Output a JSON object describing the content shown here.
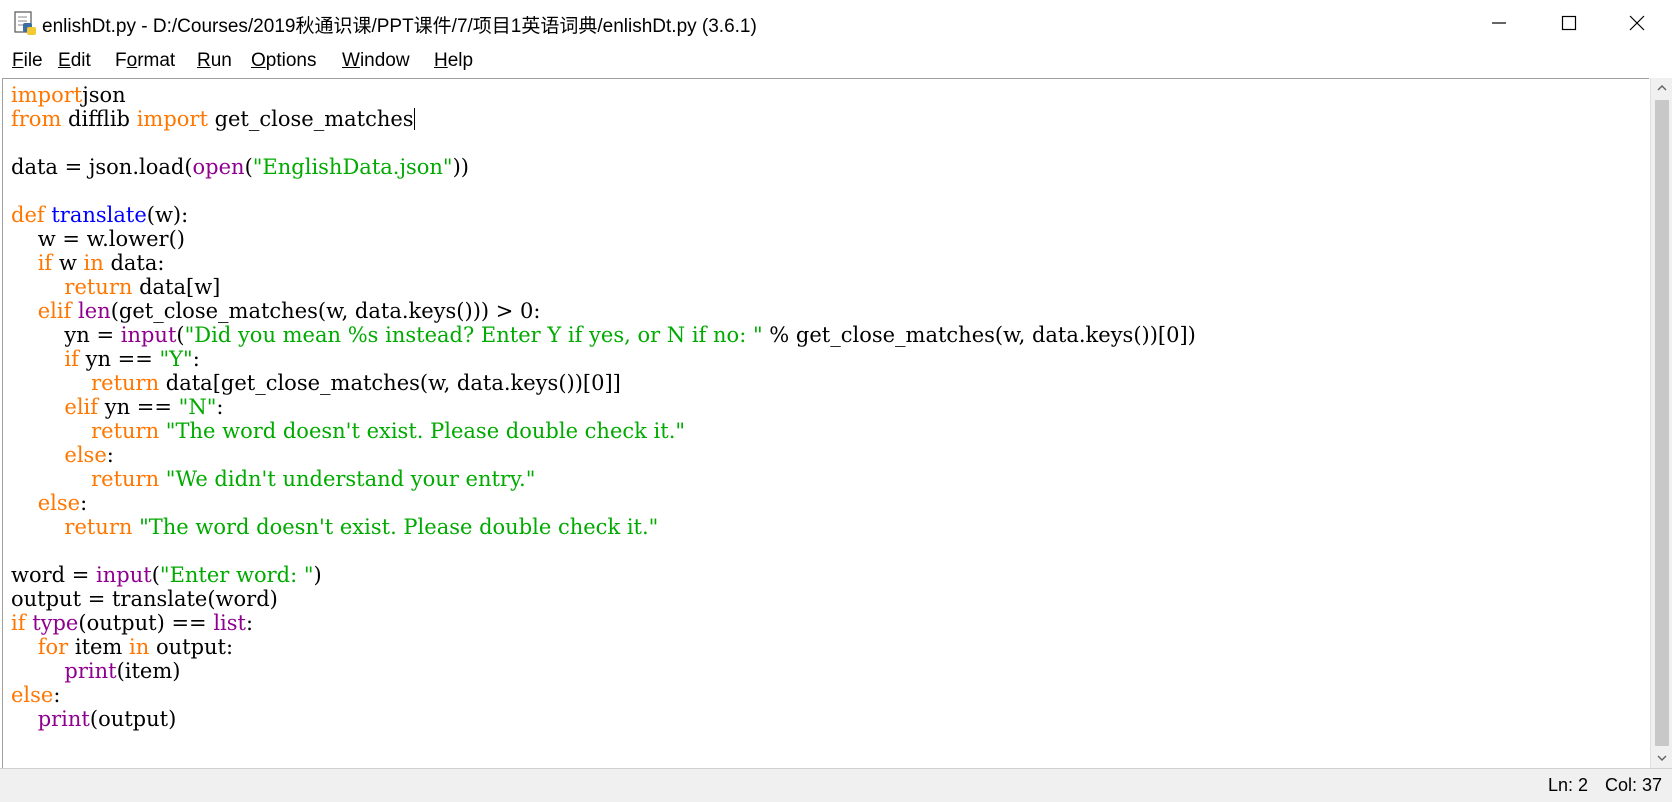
{
  "window": {
    "title": "enlishDt.py - D:/Courses/2019秋通识课/PPT课件/7/项目1英语词典/enlishDt.py (3.6.1)",
    "controls": {
      "minimize_icon": "minimize-icon",
      "maximize_icon": "maximize-icon",
      "close_icon": "close-icon"
    }
  },
  "menu": {
    "items": [
      {
        "pre": "",
        "u": "F",
        "post": "ile"
      },
      {
        "pre": "",
        "u": "E",
        "post": "dit"
      },
      {
        "pre": "F",
        "u": "o",
        "post": "rmat"
      },
      {
        "pre": "",
        "u": "R",
        "post": "un"
      },
      {
        "pre": "",
        "u": "O",
        "post": "ptions"
      },
      {
        "pre": "",
        "u": "W",
        "post": "indow"
      },
      {
        "pre": "",
        "u": "H",
        "post": "elp"
      }
    ]
  },
  "editor": {
    "lines": [
      [
        [
          "kw",
          "import"
        ],
        [
          "",
          "json"
        ]
      ],
      [
        [
          "kw",
          "from"
        ],
        [
          "",
          " difflib "
        ],
        [
          "kw",
          "import"
        ],
        [
          "",
          " get_close_matches"
        ],
        [
          "caret",
          ""
        ]
      ],
      [],
      [
        [
          "",
          "data = json.load("
        ],
        [
          "bi",
          "open"
        ],
        [
          "",
          "("
        ],
        [
          "str",
          "\"EnglishData.json\""
        ],
        [
          "",
          "))"
        ]
      ],
      [],
      [
        [
          "kw",
          "def"
        ],
        [
          "",
          " "
        ],
        [
          "def",
          "translate"
        ],
        [
          "",
          "(w):"
        ]
      ],
      [
        [
          "",
          "    w = w.lower()"
        ]
      ],
      [
        [
          "",
          "    "
        ],
        [
          "kw",
          "if"
        ],
        [
          "",
          " w "
        ],
        [
          "kw",
          "in"
        ],
        [
          "",
          " data:"
        ]
      ],
      [
        [
          "",
          "        "
        ],
        [
          "kw",
          "return"
        ],
        [
          "",
          " data[w]"
        ]
      ],
      [
        [
          "",
          "    "
        ],
        [
          "kw",
          "elif"
        ],
        [
          "",
          " "
        ],
        [
          "bi",
          "len"
        ],
        [
          "",
          "(get_close_matches(w, data.keys())) > 0:"
        ]
      ],
      [
        [
          "",
          "        yn = "
        ],
        [
          "bi",
          "input"
        ],
        [
          "",
          "("
        ],
        [
          "str",
          "\"Did you mean %s instead? Enter Y if yes, or N if no: \""
        ],
        [
          "",
          " % get_close_matches(w, data.keys())[0])"
        ]
      ],
      [
        [
          "",
          "        "
        ],
        [
          "kw",
          "if"
        ],
        [
          "",
          " yn == "
        ],
        [
          "str",
          "\"Y\""
        ],
        [
          "",
          ":"
        ]
      ],
      [
        [
          "",
          "            "
        ],
        [
          "kw",
          "return"
        ],
        [
          "",
          " data[get_close_matches(w, data.keys())[0]]"
        ]
      ],
      [
        [
          "",
          "        "
        ],
        [
          "kw",
          "elif"
        ],
        [
          "",
          " yn == "
        ],
        [
          "str",
          "\"N\""
        ],
        [
          "",
          ":"
        ]
      ],
      [
        [
          "",
          "            "
        ],
        [
          "kw",
          "return"
        ],
        [
          "",
          " "
        ],
        [
          "str",
          "\"The word doesn't exist. Please double check it.\""
        ]
      ],
      [
        [
          "",
          "        "
        ],
        [
          "kw",
          "else"
        ],
        [
          "",
          ":"
        ]
      ],
      [
        [
          "",
          "            "
        ],
        [
          "kw",
          "return"
        ],
        [
          "",
          " "
        ],
        [
          "str",
          "\"We didn't understand your entry.\""
        ]
      ],
      [
        [
          "",
          "    "
        ],
        [
          "kw",
          "else"
        ],
        [
          "",
          ":"
        ]
      ],
      [
        [
          "",
          "        "
        ],
        [
          "kw",
          "return"
        ],
        [
          "",
          " "
        ],
        [
          "str",
          "\"The word doesn't exist. Please double check it.\""
        ]
      ],
      [],
      [
        [
          "",
          "word = "
        ],
        [
          "bi",
          "input"
        ],
        [
          "",
          "("
        ],
        [
          "str",
          "\"Enter word: \""
        ],
        [
          "",
          ")"
        ]
      ],
      [
        [
          "",
          "output = translate(word)"
        ]
      ],
      [
        [
          "kw",
          "if"
        ],
        [
          "",
          " "
        ],
        [
          "bi",
          "type"
        ],
        [
          "",
          "(output) == "
        ],
        [
          "bi",
          "list"
        ],
        [
          "",
          ":"
        ]
      ],
      [
        [
          "",
          "    "
        ],
        [
          "kw",
          "for"
        ],
        [
          "",
          " item "
        ],
        [
          "kw",
          "in"
        ],
        [
          "",
          " output:"
        ]
      ],
      [
        [
          "",
          "        "
        ],
        [
          "bi",
          "print"
        ],
        [
          "",
          "(item)"
        ]
      ],
      [
        [
          "kw",
          "else"
        ],
        [
          "",
          ":"
        ]
      ],
      [
        [
          "",
          "    "
        ],
        [
          "bi",
          "print"
        ],
        [
          "",
          "(output)"
        ]
      ]
    ]
  },
  "status": {
    "line": "Ln: 2",
    "col": "Col: 37"
  },
  "colors": {
    "keyword": "#ff7700",
    "builtin": "#900090",
    "string": "#00aa00",
    "definition": "#0000ff"
  }
}
